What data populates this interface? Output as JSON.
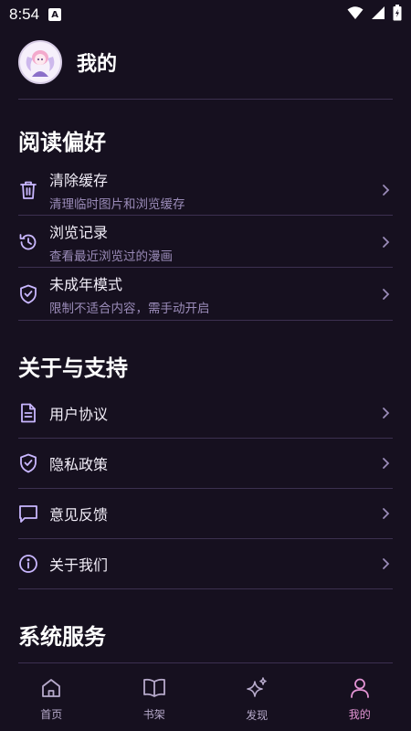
{
  "status": {
    "time": "8:54",
    "notif_badge": "A"
  },
  "profile": {
    "title": "我的"
  },
  "sections": {
    "reading": {
      "title": "阅读偏好",
      "items": [
        {
          "icon": "trash-icon",
          "label": "清除缓存",
          "sublabel": "清理临时图片和浏览缓存"
        },
        {
          "icon": "history-icon",
          "label": "浏览记录",
          "sublabel": "查看最近浏览过的漫画"
        },
        {
          "icon": "shield-check-icon",
          "label": "未成年模式",
          "sublabel": "限制不适合内容，需手动开启"
        }
      ]
    },
    "about": {
      "title": "关于与支持",
      "items": [
        {
          "icon": "document-icon",
          "label": "用户协议"
        },
        {
          "icon": "shield-check-icon",
          "label": "隐私政策"
        },
        {
          "icon": "message-icon",
          "label": "意见反馈"
        },
        {
          "icon": "info-icon",
          "label": "关于我们"
        }
      ]
    },
    "system": {
      "title": "系统服务"
    }
  },
  "tabs": [
    {
      "icon": "home-icon",
      "label": "首页",
      "active": false
    },
    {
      "icon": "book-icon",
      "label": "书架",
      "active": false
    },
    {
      "icon": "sparkles-icon",
      "label": "发现",
      "active": false
    },
    {
      "icon": "user-icon",
      "label": "我的",
      "active": true
    }
  ],
  "colors": {
    "background": "#16101f",
    "accent": "#e394d4",
    "icon": "#c9b7ff",
    "subtext": "#9a8bb8"
  }
}
